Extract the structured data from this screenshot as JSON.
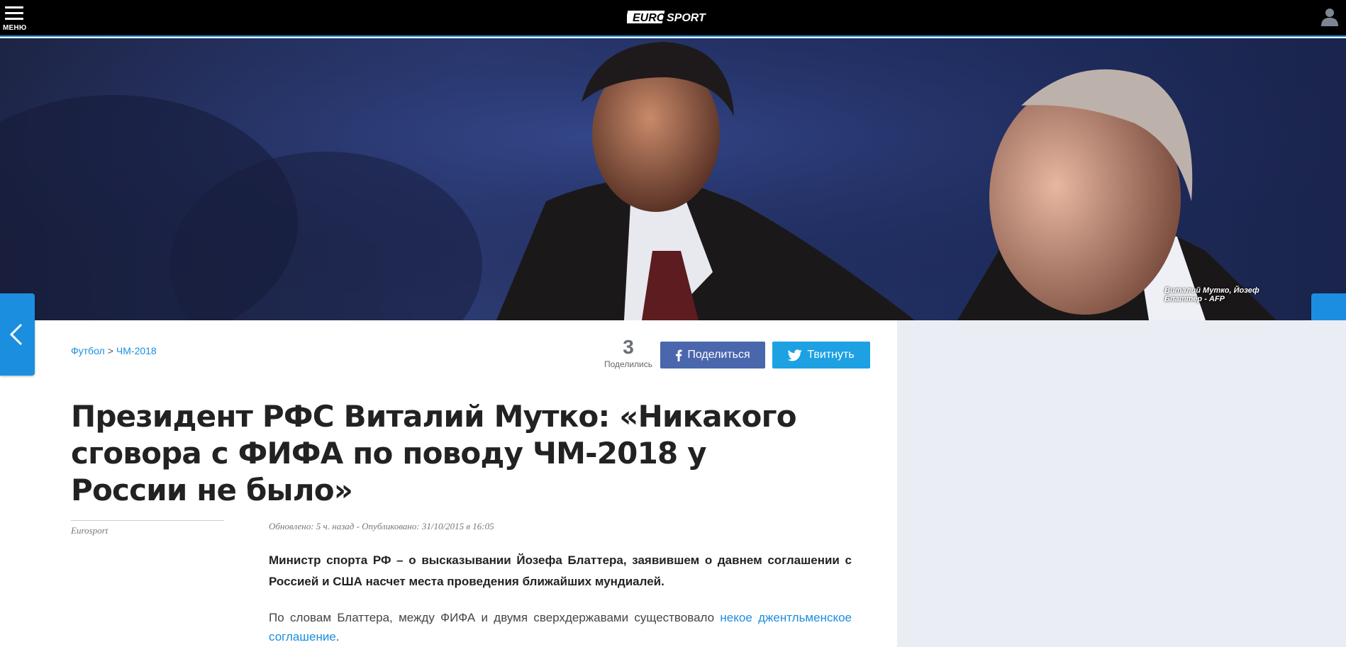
{
  "header": {
    "menu_label": "МЕНЮ",
    "logo_part1": "EURO",
    "logo_part2": "SPORT"
  },
  "hero": {
    "caption": "Виталий Мутко, Йозеф Блаттер - AFP"
  },
  "breadcrumb": {
    "items": [
      "Футбол",
      "ЧМ-2018"
    ],
    "separator": ">"
  },
  "share": {
    "count": "3",
    "count_label": "Поделились",
    "facebook_label": "Поделиться",
    "twitter_label": "Твитнуть"
  },
  "article": {
    "headline": "Президент РФС Виталий Мутко: «Никакого сговора с ФИФА по поводу ЧМ-2018 у России не было»",
    "author": "Eurosport",
    "dates": "Обновлено: 5 ч. назад - Опубликовано: 31/10/2015 в 16:05",
    "lead": "Министр спорта РФ – о высказывании Йозефа Блаттера, заявившем о давнем соглашении с Россией и США насчет места проведения ближайших мундиалей.",
    "para_text": "По словам Блаттера, между ФИФА и двумя сверхдержавами существовало ",
    "para_link": "некое джентльменское соглашение",
    "para_end": "."
  },
  "colors": {
    "accent": "#1b8ee0",
    "facebook": "#4a67ad",
    "twitter": "#1da1e2",
    "sidebar_bg": "#eaedf3"
  },
  "icons": [
    "menu-icon",
    "user-icon",
    "chevron-left-icon",
    "chevron-right-icon",
    "facebook-icon",
    "twitter-icon"
  ]
}
